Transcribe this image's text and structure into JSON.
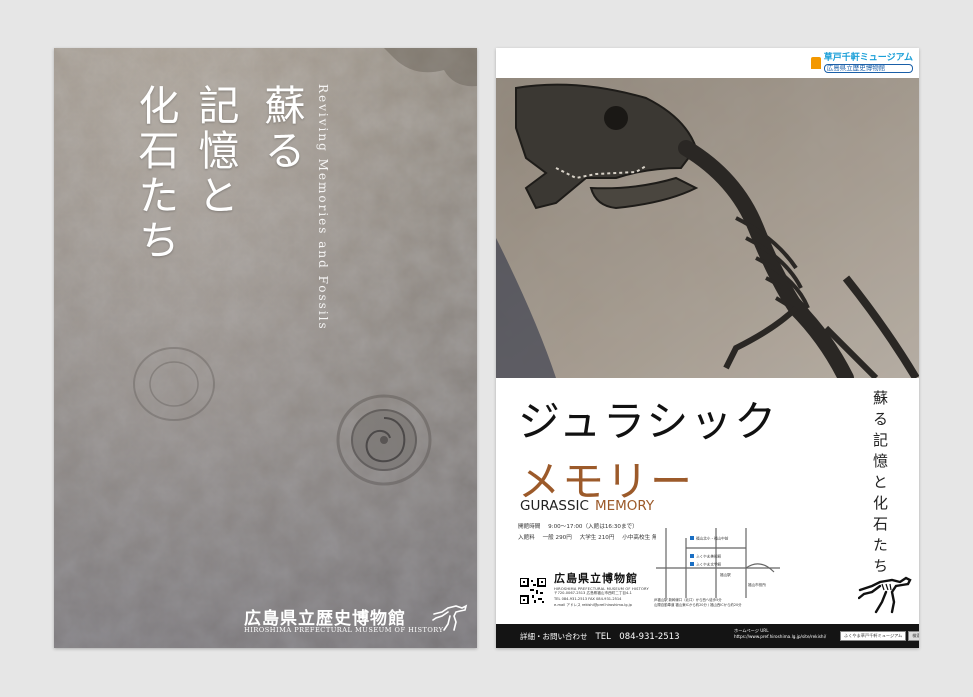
{
  "left_poster": {
    "title_columns": [
      "蘇る",
      "記憶と",
      "化石たち"
    ],
    "english_title": "Reviving Memories and Fossils",
    "museum_jp": "広島県立歴史博物館",
    "museum_en": "HIROSHIMA PREFECTURAL MUSEUM OF HISTORY"
  },
  "right_poster": {
    "logo": {
      "line1": "草戸千軒ミュージアム",
      "line2": "広島県立歴史博物館"
    },
    "title_main": "ジュラシック",
    "title_sub": "メモリー",
    "title_en_1": "GURASSIC",
    "title_en_2": "MEMORY",
    "vertical_text": "蘇る記憶と化石たち",
    "info": {
      "hours_label": "開館時間",
      "hours_value": "9:00～17:00（入館は16:30まで）",
      "fee_label": "入館料",
      "fee_general": "一般 290円",
      "fee_student": "大学生 210円",
      "fee_child": "小中高校生 無料"
    },
    "museum_jp": "広島県立博物館",
    "museum_en": "HIROSHIMA PREFECTURAL MUSEUM OF HISTORY",
    "address_lines": [
      "〒720-0067-2513 広島県福山市西町二丁目4-1",
      "TEL 084-931-2513 FAX 084-931-2514",
      "e-mail アドレス rekishi@pref.hiroshima.lg.jp"
    ],
    "map_labels": [
      "福山北小・福山中前",
      "ふくやま美術館",
      "ふくやま文学館",
      "福山駅",
      "福山市役所"
    ],
    "access_lines": [
      "JR福山駅 新幹線口（北口）から西へ徒歩5分",
      "山陽自動車道 福山東ICから約20分 / 福山西ICから約20分"
    ],
    "footer": {
      "contact_label": "詳細・お問い合わせ",
      "tel": "TEL　084-931-2513",
      "homepage_label": "ホームページ URL",
      "homepage_url": "https://www.pref.hiroshima.lg.jp/site/rekishi/",
      "search_box": "ふくやま草戸千軒ミュージアム",
      "search_button": "検索"
    }
  }
}
